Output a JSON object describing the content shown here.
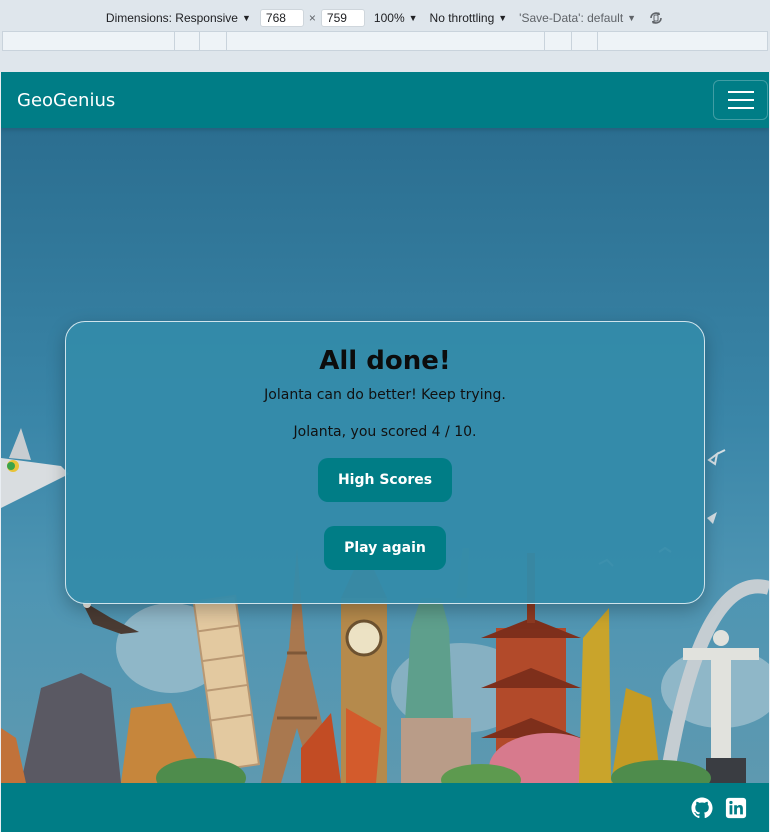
{
  "devtools": {
    "dimensions_label": "Dimensions: Responsive",
    "width_value": "768",
    "times": "×",
    "height_value": "759",
    "zoom": "100%",
    "throttling": "No throttling",
    "save_data": "'Save-Data': default",
    "rotate_icon": "rotate-icon"
  },
  "navbar": {
    "brand": "GeoGenius",
    "toggler_icon": "hamburger-icon"
  },
  "result": {
    "title": "All done!",
    "message": "Jolanta can do better! Keep trying.",
    "score": "Jolanta, you scored 4 / 10.",
    "high_scores_label": "High Scores",
    "play_again_label": "Play again"
  },
  "footer": {
    "icons": [
      "github-icon",
      "linkedin-icon"
    ]
  },
  "colors": {
    "teal": "#007d86",
    "card": "#348baa"
  }
}
